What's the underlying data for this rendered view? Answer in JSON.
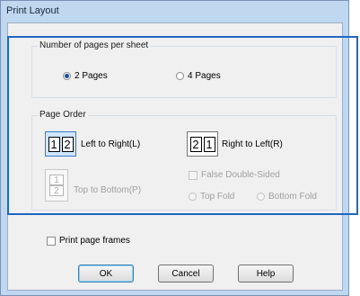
{
  "dialog": {
    "title": "Print Layout"
  },
  "pages_per_sheet": {
    "legend": "Number of pages per sheet",
    "options": [
      {
        "label": "2 Pages",
        "checked": true
      },
      {
        "label": "4 Pages",
        "checked": false
      }
    ]
  },
  "page_order": {
    "legend": "Page Order",
    "left_to_right": {
      "label": "Left to Right(L)",
      "pages": [
        "1",
        "2"
      ],
      "selected": true
    },
    "right_to_left": {
      "label": "Right to Left(R)",
      "pages": [
        "2",
        "1"
      ],
      "selected": false
    },
    "top_to_bottom": {
      "label": "Top to Bottom(P)",
      "pages": [
        "1",
        "2"
      ],
      "enabled": false
    },
    "false_double_sided": {
      "label": "False Double-Sided",
      "enabled": false
    },
    "top_fold": {
      "label": "Top Fold",
      "enabled": false
    },
    "bottom_fold": {
      "label": "Bottom Fold",
      "enabled": false
    }
  },
  "print_page_frames": {
    "label": "Print page frames",
    "checked": false
  },
  "buttons": {
    "ok": "OK",
    "cancel": "Cancel",
    "help": "Help"
  },
  "colors": {
    "highlight_box": "#1e68c0",
    "selected_button": "#cfe6fb",
    "window_frame": "#bfd7ef"
  }
}
